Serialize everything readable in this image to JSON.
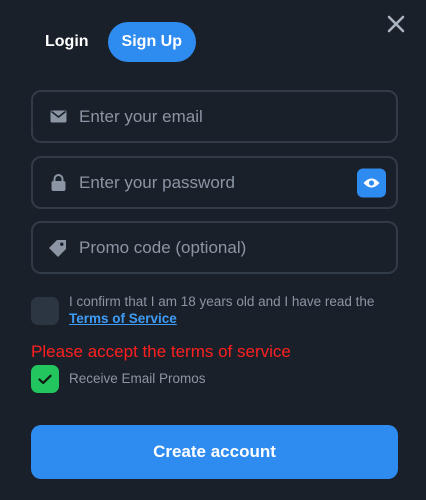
{
  "tabs": {
    "login_label": "Login",
    "signup_label": "Sign Up",
    "active": "signup"
  },
  "form": {
    "email": {
      "placeholder": "Enter your email",
      "value": "",
      "icon": "mail-icon"
    },
    "password": {
      "placeholder": "Enter your password",
      "value": "",
      "icon": "lock-icon",
      "toggle_icon": "eye-icon"
    },
    "promo": {
      "placeholder": "Promo code (optional)",
      "value": "",
      "icon": "tag-icon"
    }
  },
  "terms": {
    "checked": false,
    "text_before": "I confirm that I am 18 years old and I have read the ",
    "link_label": "Terms of Service"
  },
  "error_message": "Please accept the terms of service",
  "email_promos": {
    "checked": true,
    "label": "Receive Email Promos"
  },
  "submit_label": "Create account",
  "colors": {
    "background": "#1a2029",
    "accent": "#2e8bf0",
    "error": "#ff1f1f",
    "success": "#22c55e",
    "muted_text": "#8b95a4"
  }
}
